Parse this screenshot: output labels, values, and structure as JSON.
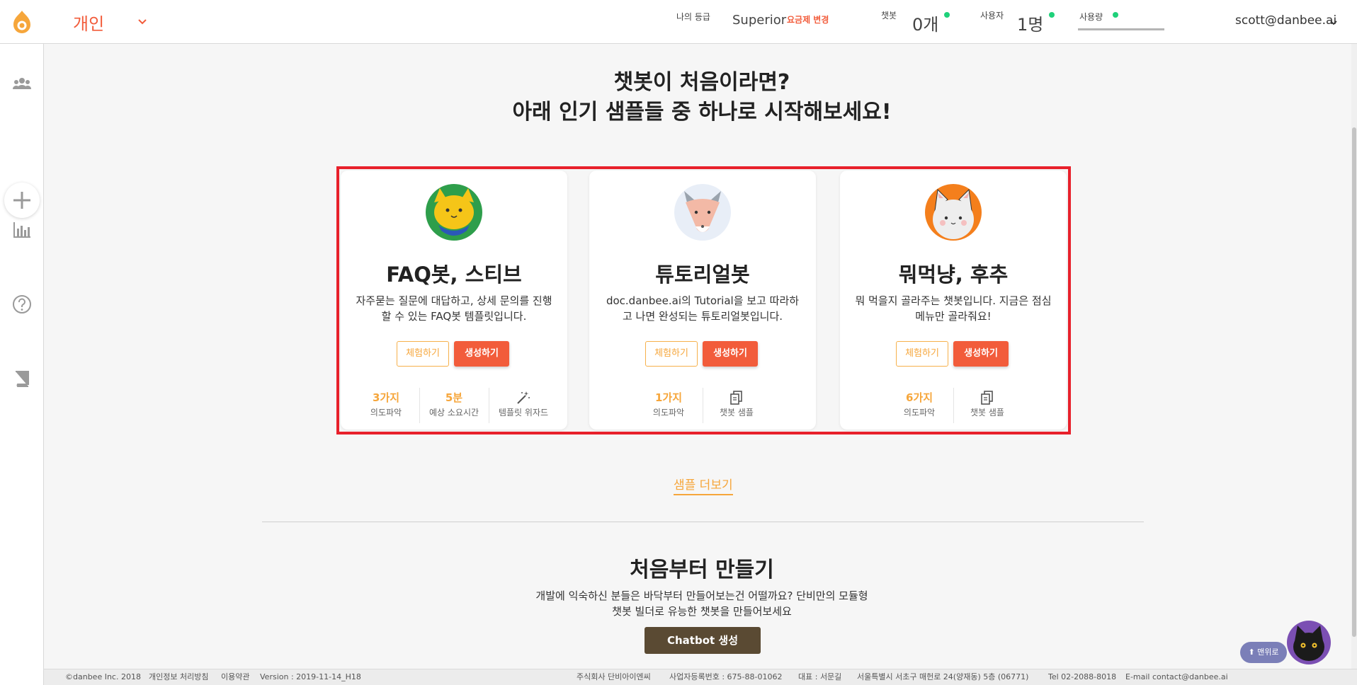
{
  "header": {
    "workspace": "개인",
    "grade_label": "나의 등급",
    "grade_value": "Superior",
    "plan_change": "요금제 변경",
    "chatbot_label": "챗봇",
    "chatbot_count": "0개",
    "users_label": "사용자",
    "users_count": "1명",
    "usage_label": "사용량",
    "account": "scott@danbee.ai"
  },
  "sidebar": {
    "icons": [
      "people-icon",
      "plus-icon",
      "bar-chart-icon",
      "help-icon",
      "book-icon"
    ]
  },
  "hero": {
    "line1": "챗봇이 처음이라면?",
    "line2": "아래 인기 샘플들 중 하나로 시작해보세요!"
  },
  "cards": [
    {
      "title": "FAQ봇, 스티브",
      "desc": "자주묻는 질문에 대답하고, 상세 문의를 진행할 수 있는 FAQ봇 템플릿입니다.",
      "try_label": "체험하기",
      "create_label": "생성하기",
      "stats": [
        {
          "value": "3가지",
          "label": "의도파악"
        },
        {
          "value": "5분",
          "label": "예상 소요시간"
        },
        {
          "icon": "magic-wand-icon",
          "label": "템플릿 위자드"
        }
      ]
    },
    {
      "title": "튜토리얼봇",
      "desc": "doc.danbee.ai의 Tutorial을 보고 따라하고 나면 완성되는 튜토리얼봇입니다.",
      "try_label": "체험하기",
      "create_label": "생성하기",
      "stats": [
        {
          "value": "1가지",
          "label": "의도파악"
        },
        {
          "icon": "document-copy-icon",
          "label": "챗봇 샘플"
        }
      ]
    },
    {
      "title": "뭐먹냥, 후추",
      "desc": "뭐 먹을지 골라주는 챗봇입니다. 지금은 점심메뉴만 골라줘요!",
      "try_label": "체험하기",
      "create_label": "생성하기",
      "stats": [
        {
          "value": "6가지",
          "label": "의도파악"
        },
        {
          "icon": "document-copy-icon",
          "label": "챗봇 샘플"
        }
      ]
    }
  ],
  "more_samples": "샘플 더보기",
  "scratch": {
    "title": "처음부터 만들기",
    "desc_line1": "개발에 익숙하신 분들은 바닥부터 만들어보는건 어떨까요? 단비만의 모듈형",
    "desc_line2": "챗봇 빌더로 유능한 챗봇을 만들어보세요",
    "button": "Chatbot 생성"
  },
  "footer": {
    "copyright": "©danbee Inc. 2018",
    "privacy": "개인정보 처리방침",
    "terms": "이용약관",
    "version": "Version : 2019-11-14_H18",
    "company": "주식회사 단비아이엔씨",
    "biz_no": "사업자등록번호 : 675-88-01062",
    "ceo": "대표 : 서문길",
    "address": "서울특별시 서초구 매헌로 24(양재동) 5층 (06771)",
    "tel": "Tel 02-2088-8018",
    "email": "E-mail contact@danbee.ai"
  },
  "floating": {
    "top_button": "⬆ 맨위로"
  },
  "colors": {
    "accent": "#f25c3b",
    "orange": "#f6a63b",
    "highlight": "#e8202b",
    "online": "#1fd17a",
    "dark_button": "#5a4a33"
  }
}
